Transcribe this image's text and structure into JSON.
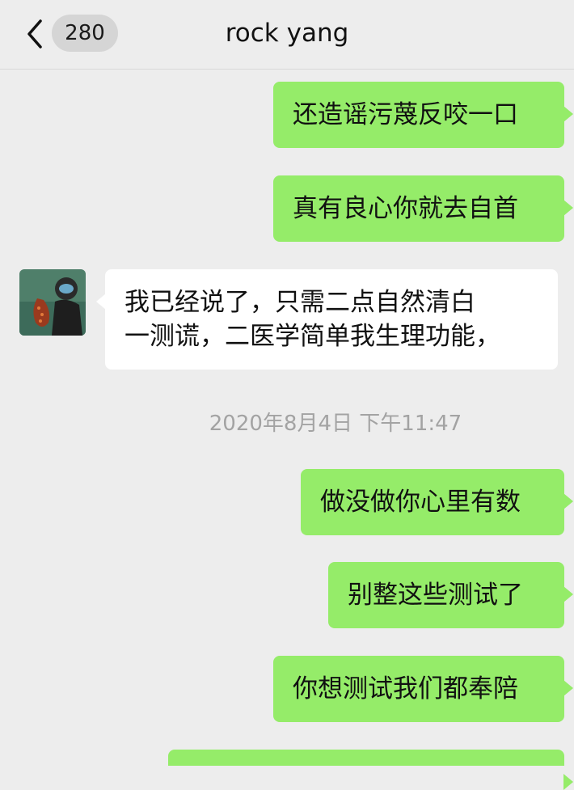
{
  "header": {
    "unread_count": "280",
    "title": "rock yang"
  },
  "messages": [
    {
      "direction": "out",
      "text": "还造谣污蔑反咬一口"
    },
    {
      "direction": "out",
      "text": "真有良心你就去自首"
    },
    {
      "direction": "in",
      "lines": [
        "我已经说了，只需二点自然清白",
        "一测谎，二医学简单我生理功能，"
      ]
    },
    {
      "timestamp": "2020年8月4日 下午11:47"
    },
    {
      "direction": "out",
      "text": "做没做你心里有数"
    },
    {
      "direction": "out",
      "text": "别整这些测试了"
    },
    {
      "direction": "out",
      "text": "你想测试我们都奉陪"
    }
  ],
  "colors": {
    "background": "#ededed",
    "outgoing_bubble": "#95ec69",
    "incoming_bubble": "#ffffff",
    "timestamp_text": "#a3a3a3"
  },
  "icons": {
    "back": "chevron-left-icon",
    "avatar": "diver-photo-avatar"
  }
}
